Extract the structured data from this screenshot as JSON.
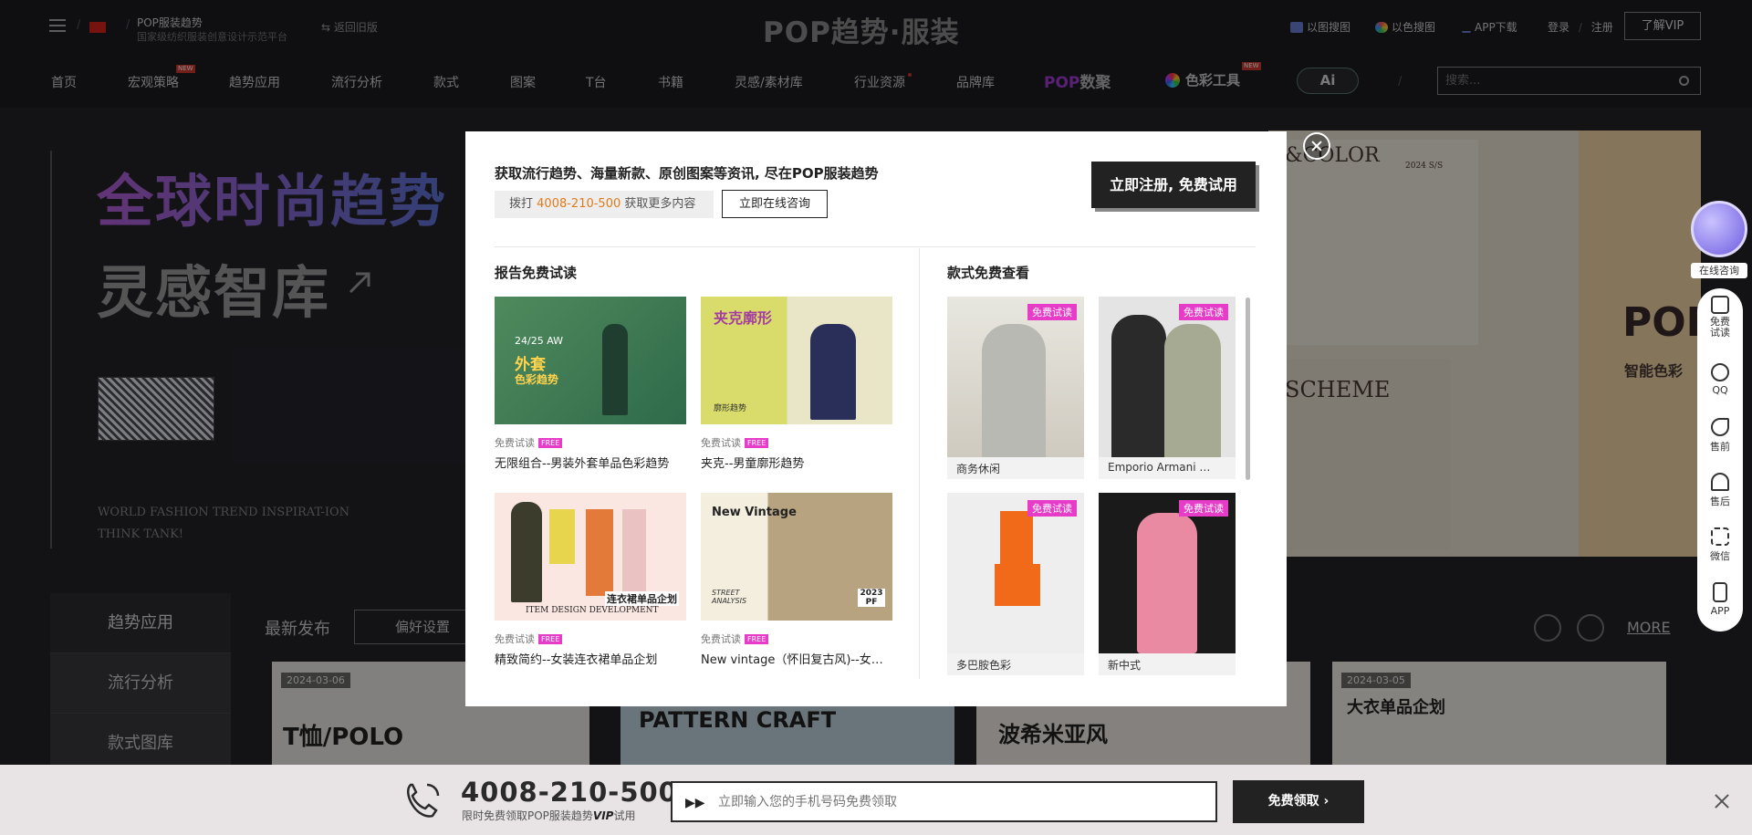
{
  "topbar": {
    "brand_title": "POP服装趋势",
    "brand_sub": "国家级纺织服装创意设计示范平台",
    "old_version": "返回旧版",
    "logo": "POP趋势·服装",
    "tools": [
      "以图搜图",
      "以色搜图",
      "APP下载"
    ],
    "login": "登录",
    "register": "注册",
    "vip": "了解VIP"
  },
  "nav": {
    "items": [
      "首页",
      "宏观策略",
      "趋势应用",
      "流行分析",
      "款式",
      "图案",
      "T台",
      "书籍",
      "灵感/素材库",
      "行业资源",
      "品牌库"
    ],
    "new_badge": "NEW",
    "pop_data_a": "POP",
    "pop_data_b": "数聚",
    "color_tool": "色彩工具",
    "ai": "Ai",
    "search_placeholder": "搜索..."
  },
  "hero": {
    "title1": "全球时尚趋势",
    "title2": "灵感智库",
    "en1": "WORLD FASHION TREND INSPIRAT-ION",
    "en2": "THINK TANK!",
    "banner_color": "&COLOR",
    "banner_season": "2024 S/S",
    "banner_scheme": "SCHEME",
    "banner_pop": "POP",
    "banner_tag": "智能色彩"
  },
  "lower": {
    "tabs": [
      "趋势应用",
      "流行分析",
      "款式图库"
    ],
    "latest": "最新发布",
    "pref": "偏好设置",
    "more": "MORE",
    "cards": [
      {
        "date": "2024-03-06",
        "title": "T恤/POLO"
      },
      {
        "date": "",
        "title": "PATTERN CRAFT"
      },
      {
        "date": "",
        "title": "波希米亚风"
      },
      {
        "date": "2024-03-05",
        "title": "大衣单品企划"
      }
    ]
  },
  "modal": {
    "headline": "获取流行趋势、海量新款、原创图案等资讯, 尽在POP服装趋势",
    "phone_prefix": "拨打",
    "phone": "4008-210-500",
    "phone_suffix": "获取更多内容",
    "consult": "立即在线咨询",
    "register": "立即注册, 免费试用",
    "reports_title": "报告免费试读",
    "styles_title": "款式免费查看",
    "trial_label": "免费试读",
    "free_tag": "FREE",
    "style_badge": "免费试读",
    "reports": [
      {
        "name": "无限组合--男装外套单品色彩趋势",
        "img_text": "外套",
        "img_sub": "色彩趋势",
        "season": "24/25 AW"
      },
      {
        "name": "夹克--男童廓形趋势",
        "img_text": "夹克廓形",
        "img_sub": "廓形趋势",
        "season": ""
      },
      {
        "name": "精致简约--女装连衣裙单品企划",
        "img_text": "连衣裙单品企划",
        "img_sub": "ITEM DESIGN DEVELOPMENT",
        "season": ""
      },
      {
        "name": "New vintage（怀旧复古风)--女…",
        "img_text": "New Vintage",
        "img_sub": "STREET ANALYSIS",
        "season": "2023 PF"
      }
    ],
    "styles": [
      {
        "caption": "商务休闲"
      },
      {
        "caption": "Emporio Armani …"
      },
      {
        "caption": "多巴胺色彩"
      },
      {
        "caption": "新中式"
      }
    ]
  },
  "float": {
    "chat_label": "在线咨询",
    "items": [
      "免费试读",
      "QQ",
      "售前",
      "售后",
      "微信",
      "APP"
    ]
  },
  "bottom_bar": {
    "phone": "4008-210-500",
    "sub_a": "限时免费领取POP服装趋势",
    "sub_vip": "VIP",
    "sub_b": "试用",
    "input_placeholder": "立即输入您的手机号码免费领取",
    "button": "免费领取"
  },
  "colors": {
    "accent_pink": "#e63cc8",
    "phone_orange": "#e07a1a",
    "dark": "#222222"
  }
}
